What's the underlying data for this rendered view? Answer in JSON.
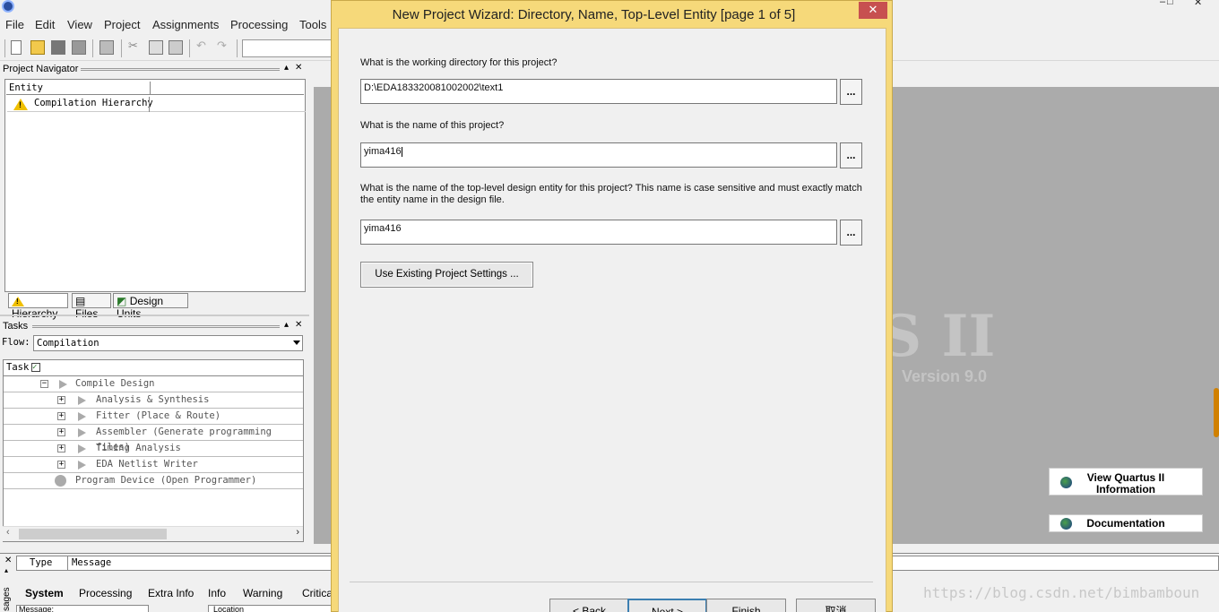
{
  "app": {
    "menu": [
      "File",
      "Edit",
      "View",
      "Project",
      "Assignments",
      "Processing",
      "Tools"
    ],
    "window_controls": [
      "–",
      "□",
      "✕"
    ]
  },
  "navigator": {
    "title": "Project Navigator",
    "column_entity": "Entity",
    "row_label": "Compilation Hierarchy",
    "tabs": [
      "Hierarchy",
      "Files",
      "Design Units"
    ]
  },
  "tasks": {
    "title": "Tasks",
    "flow_label": "Flow:",
    "flow_value": "Compilation",
    "column_task": "Task",
    "rows": [
      "Compile Design",
      "Analysis & Synthesis",
      "Fitter (Place & Route)",
      "Assembler (Generate programming files)",
      "Timing Analysis",
      "EDA Netlist Writer",
      "Program Device (Open Programmer)"
    ]
  },
  "splash": {
    "logo_fragment": "S II",
    "version": "Version 9.0",
    "view_info_line1": "View Quartus II",
    "view_info_line2": "Information",
    "documentation": "Documentation"
  },
  "messages": {
    "col_type": "Type",
    "col_message": "Message",
    "side_label": "sages",
    "tabs": [
      "System",
      "Processing",
      "Extra Info",
      "Info",
      "Warning",
      "Critical"
    ],
    "bottom_field": "Message:",
    "location_field": "Location"
  },
  "watermark": "https://blog.csdn.net/bimbamboun",
  "dialog": {
    "title": "New Project Wizard: Directory, Name, Top-Level Entity [page 1 of 5]",
    "close": "✕",
    "q_directory": "What is the working directory for this project?",
    "directory_value": "D:\\EDA183320081002002\\text1",
    "q_name": "What is the name of this project?",
    "name_value": "yima416",
    "q_top": "What is the name of the top-level design entity for this project? This name is case sensitive and must exactly match the entity name in the design file.",
    "top_value": "yima416",
    "browse": "...",
    "use_existing": "Use Existing Project Settings ...",
    "back": "< Back",
    "next": "Next >",
    "finish": "Finish",
    "cancel": "取消"
  }
}
